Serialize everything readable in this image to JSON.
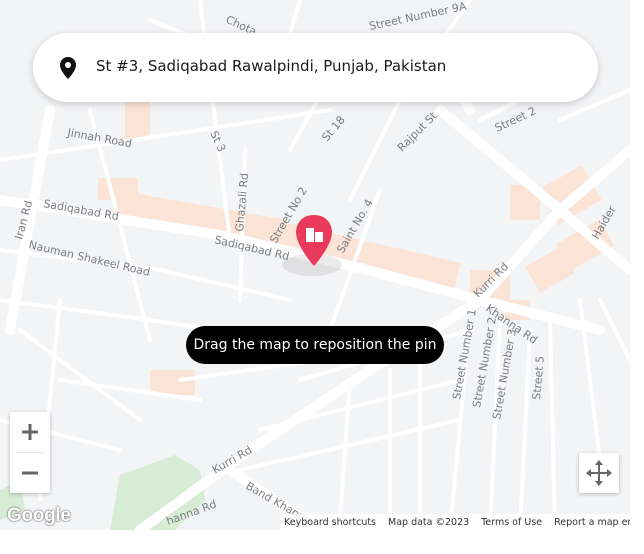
{
  "search": {
    "address": "St #3, Sadiqabad Rawalpindi, Punjab, Pakistan",
    "icon": "location-pin-icon"
  },
  "map": {
    "hint": "Drag the map to reposition the pin",
    "marker_icon": "building-icon",
    "marker_color": "#ea3a5c",
    "road_labels": [
      "Chota",
      "Street Number 9A",
      "Jinnah Road",
      "St 3",
      "St 18",
      "Rajput St",
      "Street 2",
      "Iran Rd",
      "Sadiqabad Rd",
      "Ghazali Rd",
      "Street No 2",
      "Saint No. 4",
      "Haider",
      "Nauman Shakeel Road",
      "Sadiqabad Rd",
      "Kurri Rd",
      "Khanna Rd",
      "Street Number 1",
      "Street Number 2",
      "Street Number 3",
      "Street 5",
      "Kurri Rd",
      "Band Khanna",
      "hanna Rd"
    ]
  },
  "controls": {
    "zoom_in": "+",
    "zoom_out": "−",
    "pan_icon": "move-arrows-icon"
  },
  "footer": {
    "logo": "Google",
    "keyboard_shortcuts": "Keyboard shortcuts",
    "map_data": "Map data ©2023",
    "terms": "Terms of Use",
    "report": "Report a map error"
  }
}
